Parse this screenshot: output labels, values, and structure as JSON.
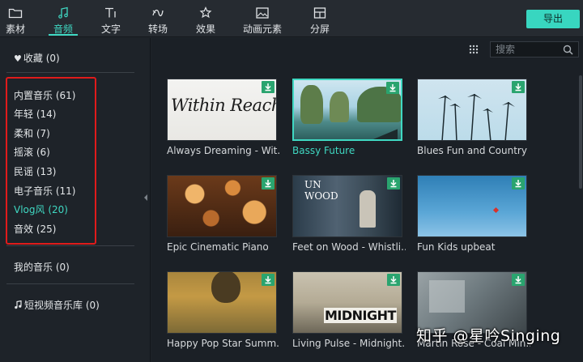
{
  "toolbar": {
    "tabs": [
      {
        "label": "素材",
        "icon": "folder-icon"
      },
      {
        "label": "音频",
        "icon": "music-note-icon"
      },
      {
        "label": "文字",
        "icon": "text-icon"
      },
      {
        "label": "转场",
        "icon": "transition-icon"
      },
      {
        "label": "效果",
        "icon": "effects-icon"
      },
      {
        "label": "动画元素",
        "icon": "image-icon"
      },
      {
        "label": "分屏",
        "icon": "split-screen-icon"
      }
    ],
    "active_tab": "音频",
    "export_label": "导出"
  },
  "sidebar": {
    "favorites": "收藏 (0)",
    "categories": [
      {
        "label": "内置音乐 (61)"
      },
      {
        "label": "年轻 (14)"
      },
      {
        "label": "柔和 (7)"
      },
      {
        "label": "摇滚 (6)"
      },
      {
        "label": "民谣 (13)"
      },
      {
        "label": "电子音乐 (11)"
      },
      {
        "label": "Vlog风 (20)"
      },
      {
        "label": "音效 (25)"
      }
    ],
    "selected_category": "Vlog风 (20)",
    "my_music": "我的音乐 (0)",
    "short_video_library": "短视频音乐库 (0)"
  },
  "search": {
    "placeholder": "搜索"
  },
  "cards": [
    {
      "title": "Always Dreaming - Wit...",
      "thumb_text": "Within Reach"
    },
    {
      "title": "Bassy Future",
      "selected": true
    },
    {
      "title": "Blues Fun and Country"
    },
    {
      "title": "Epic Cinematic Piano"
    },
    {
      "title": "Feet on Wood - Whistli...",
      "thumb_text": "UN WOOD"
    },
    {
      "title": "Fun Kids upbeat"
    },
    {
      "title": "Happy Pop Star Summ..."
    },
    {
      "title": "Living Pulse - Midnight...",
      "thumb_text": "MIDNIGHT"
    },
    {
      "title": "Martin Rose - Coal Min..."
    }
  ],
  "watermark": "知乎 @星吟Singing",
  "colors": {
    "accent": "#3fd8c2",
    "highlight_box": "#e01b1b",
    "download_badge": "#2aa46f"
  }
}
